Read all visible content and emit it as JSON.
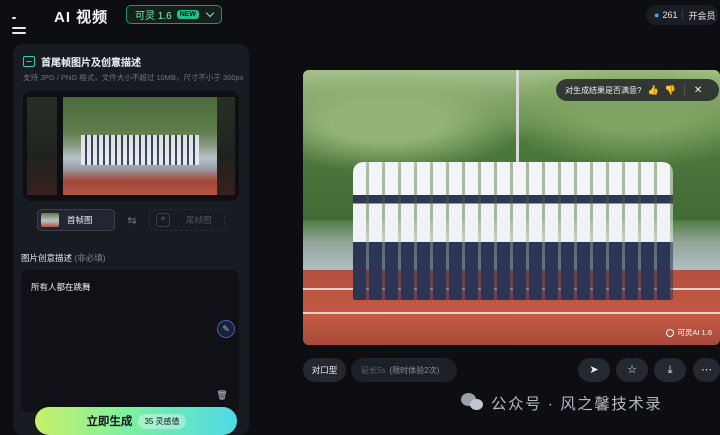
{
  "header": {
    "app_title": "AI 视频",
    "model": {
      "name": "可灵 1.6",
      "badge": "NEW"
    },
    "credits": {
      "count": "261",
      "vip_label": "开会员"
    }
  },
  "left_panel": {
    "section_title": "首尾帧图片及创意描述",
    "upload_hint": "支持 JPG / PNG 格式，文件大小不超过 10MB，尺寸不小于 300px",
    "first_frame_label": "首帧图",
    "last_frame_label": "尾帧图",
    "description_label": "图片创意描述",
    "description_optional": "(非必填)",
    "description_text": "所有人都在跳舞",
    "generate_label": "立即生成",
    "generate_cost": "35 灵感值"
  },
  "preview": {
    "feedback_question": "对生成结果是否满意?",
    "watermark": "可灵AI 1.6"
  },
  "actions": {
    "lip_sync_label": "对口型",
    "extend_label": "延长5s",
    "extend_note": "(限时体验2次)"
  },
  "watermark_overlay": "公众号 · 风之馨技术录"
}
